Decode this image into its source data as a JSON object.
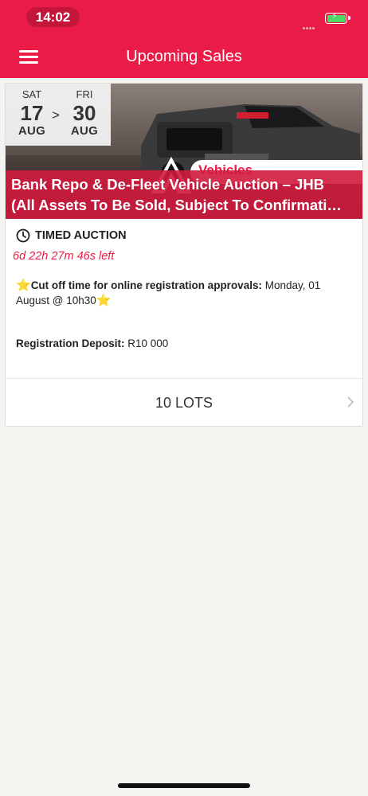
{
  "status_bar": {
    "time": "14:02"
  },
  "header": {
    "title": "Upcoming Sales"
  },
  "sale": {
    "start": {
      "dow": "SAT",
      "day": "17",
      "month": "AUG"
    },
    "separator": ">",
    "end": {
      "dow": "FRI",
      "day": "30",
      "month": "AUG"
    },
    "banner_brand": "Vehicles",
    "title_line1": "Bank Repo & De-Fleet Vehicle Auction – JHB",
    "title_line2": "(All Assets To Be Sold, Subject To Confirmati…",
    "auction_type": "TIMED AUCTION",
    "countdown": "6d 22h 27m 46s left",
    "notice_bold": "Cut off time for online registration approvals:",
    "notice_text": " Monday, 01 August @ 10h30",
    "deposit_label": "Registration Deposit:",
    "deposit_value": " R10 000",
    "lots": "10 LOTS"
  },
  "icons": {
    "menu": "menu-icon",
    "clock": "clock-icon",
    "star": "star-icon",
    "chevron": "chevron-right-icon",
    "battery": "battery-charging-icon"
  },
  "colors": {
    "brand": "#ea1c47",
    "countdown": "#ea1c47",
    "star": "#f5c518"
  }
}
